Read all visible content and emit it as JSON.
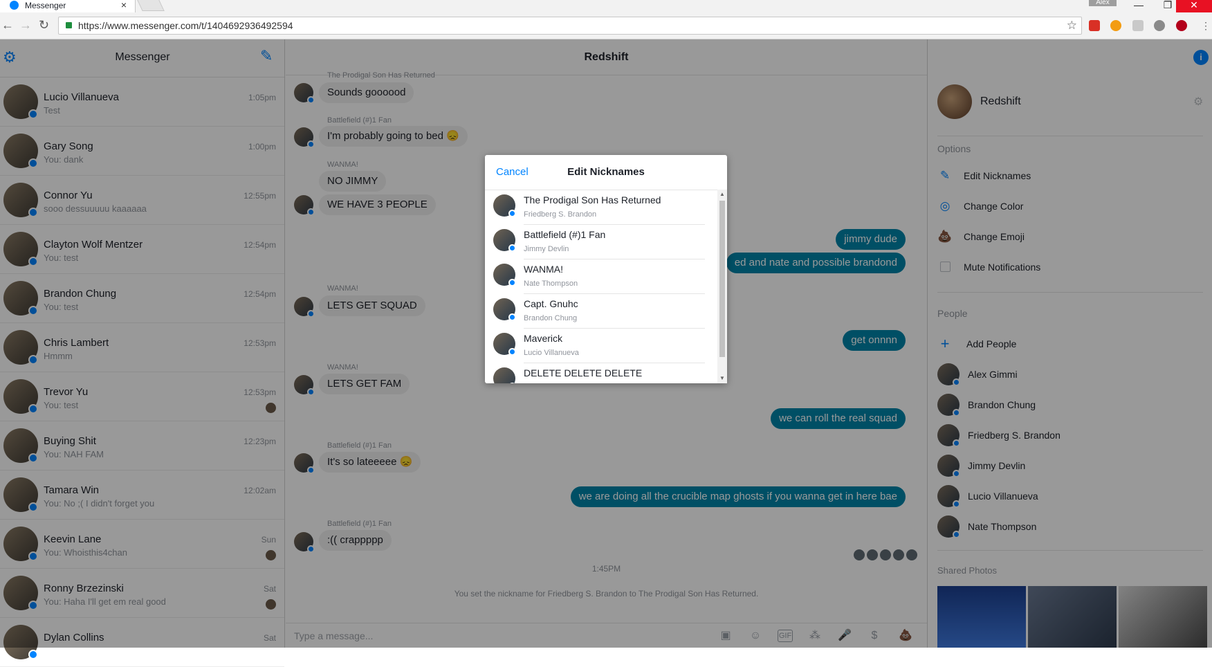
{
  "browser": {
    "tab_title": "Messenger",
    "tab_close": "×",
    "user_chip": "Alex",
    "url": "https://www.messenger.com/t/1404692936492594",
    "back": "←",
    "forward": "→",
    "reload": "↻",
    "star": "☆",
    "minimize": "—",
    "restore": "❐",
    "close": "✕"
  },
  "left": {
    "title": "Messenger",
    "conversations": [
      {
        "name": "Lucio Villanueva",
        "snippet": "Test",
        "time": "1:05pm"
      },
      {
        "name": "Gary Song",
        "snippet": "You: dank",
        "time": "1:00pm"
      },
      {
        "name": "Connor Yu",
        "snippet": "sooo dessuuuuu kaaaaaa",
        "time": "12:55pm"
      },
      {
        "name": "Clayton Wolf Mentzer",
        "snippet": "You: test",
        "time": "12:54pm"
      },
      {
        "name": "Brandon Chung",
        "snippet": "You: test",
        "time": "12:54pm"
      },
      {
        "name": "Chris Lambert",
        "snippet": "Hmmm",
        "time": "12:53pm"
      },
      {
        "name": "Trevor Yu",
        "snippet": "You: test",
        "time": "12:53pm"
      },
      {
        "name": "Buying Shit",
        "snippet": "You: NAH FAM",
        "time": "12:23pm"
      },
      {
        "name": "Tamara Win",
        "snippet": "You: No ;( I didn't forget you",
        "time": "12:02am"
      },
      {
        "name": "Keevin Lane",
        "snippet": "You: Whoisthis4chan",
        "time": "Sun"
      },
      {
        "name": "Ronny Brzezinski",
        "snippet": "You: Haha I'll get em real good",
        "time": "Sat"
      },
      {
        "name": "Dylan Collins",
        "snippet": "",
        "time": "Sat"
      }
    ]
  },
  "center": {
    "title": "Redshift",
    "messages": [
      {
        "sender": "The Prodigal Son Has Returned",
        "text": "Sounds goooood"
      },
      {
        "sender": "Battlefield (#)1 Fan",
        "text": "I'm probably going to bed 😞"
      },
      {
        "sender": "WANMA!",
        "text": "NO JIMMY"
      },
      {
        "sender": "",
        "text": "WE HAVE 3 PEOPLE"
      },
      {
        "sender": "",
        "text": "jimmy dude"
      },
      {
        "sender": "",
        "text": "ed and nate and possible brandond"
      },
      {
        "sender": "WANMA!",
        "text": "LETS GET SQUAD"
      },
      {
        "sender": "",
        "text": "get onnnn"
      },
      {
        "sender": "WANMA!",
        "text": "LETS GET FAM"
      },
      {
        "sender": "",
        "text": "we can roll the real squad"
      },
      {
        "sender": "Battlefield (#)1 Fan",
        "text": "It's so lateeeee 😞"
      },
      {
        "sender": "",
        "text": "we are doing all the crucible map ghosts if you wanna get in here bae"
      },
      {
        "sender": "Battlefield (#)1 Fan",
        "text": ":(( crappppp"
      }
    ],
    "timestamp": "1:45PM",
    "system_note": "You set the nickname for Friedberg S. Brandon to The Prodigal Son Has Returned.",
    "composer_placeholder": "Type a message...",
    "composer_icons": [
      "image-icon",
      "emoji-icon",
      "gif-icon",
      "stickers-icon",
      "microphone-icon",
      "payment-icon",
      "poop-emoji-icon"
    ],
    "gif_label": "GIF"
  },
  "right": {
    "group_name": "Redshift",
    "options_label": "Options",
    "options": [
      "Edit Nicknames",
      "Change Color",
      "Change Emoji",
      "Mute Notifications"
    ],
    "people_label": "People",
    "add_people": "Add People",
    "people": [
      "Alex Gimmi",
      "Brandon Chung",
      "Friedberg S. Brandon",
      "Jimmy Devlin",
      "Lucio Villanueva",
      "Nate Thompson"
    ],
    "shared_photos_label": "Shared Photos"
  },
  "dialog": {
    "cancel": "Cancel",
    "title": "Edit Nicknames",
    "items": [
      {
        "nickname": "The Prodigal Son Has Returned",
        "real_name": "Friedberg S. Brandon"
      },
      {
        "nickname": "Battlefield (#)1 Fan",
        "real_name": "Jimmy Devlin"
      },
      {
        "nickname": "WANMA!",
        "real_name": "Nate Thompson"
      },
      {
        "nickname": "Capt. Gnuhc",
        "real_name": "Brandon Chung"
      },
      {
        "nickname": "Maverick",
        "real_name": "Lucio Villanueva"
      },
      {
        "nickname": "DELETE DELETE DELETE",
        "real_name": ""
      }
    ]
  },
  "colors": {
    "accent": "#0084ff",
    "my_bubble": "#0084a8",
    "their_bubble": "#f1f0f0"
  }
}
